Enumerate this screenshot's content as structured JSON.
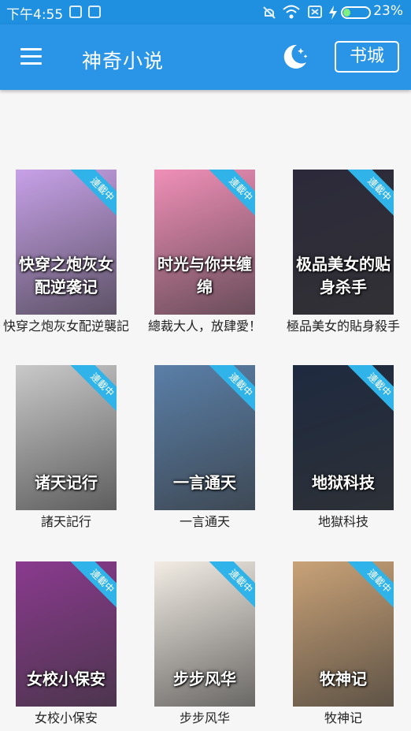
{
  "status_bar": {
    "time": "下午4:55",
    "battery": "23%"
  },
  "app_bar": {
    "title": "神奇小说",
    "store_button": "书城",
    "menu_icon": "hamburger-menu-icon",
    "night_mode_icon": "moon-stars-icon"
  },
  "colors": {
    "primary": "#2a95e6",
    "status_bar": "#1f8fe0",
    "ribbon": "#2fb3e8",
    "background": "#f6f6f6"
  },
  "books": [
    {
      "title": "快穿之炮灰女配逆襲記",
      "badge": "連載中",
      "cover_text": "快穿之炮灰女配逆袭记",
      "cover_color": "#c7a1e8"
    },
    {
      "title": "總裁大人，放肆愛！",
      "badge": "連載中",
      "cover_text": "时光与你共缠绵",
      "cover_color": "#f08fb8"
    },
    {
      "title": "極品美女的貼身殺手",
      "badge": "連載中",
      "cover_text": "极品美女的贴身杀手",
      "cover_color": "#2c2a3a"
    },
    {
      "title": "諸天記行",
      "badge": "連載中",
      "cover_text": "诸天记行",
      "cover_color": "#c9c9c9"
    },
    {
      "title": "一言通天",
      "badge": "連載中",
      "cover_text": "一言通天",
      "cover_color": "#5a7fa8"
    },
    {
      "title": "地獄科技",
      "badge": "連載中",
      "cover_text": "地狱科技",
      "cover_color": "#1e2a40"
    },
    {
      "title": "女校小保安",
      "badge": "連載中",
      "cover_text": "女校小保安",
      "cover_color": "#8a3a8e"
    },
    {
      "title": "步步风华",
      "badge": "連載中",
      "cover_text": "步步风华",
      "cover_color": "#f2ece4"
    },
    {
      "title": "牧神记",
      "badge": "連載中",
      "cover_text": "牧神记",
      "cover_color": "#c9a277"
    }
  ]
}
